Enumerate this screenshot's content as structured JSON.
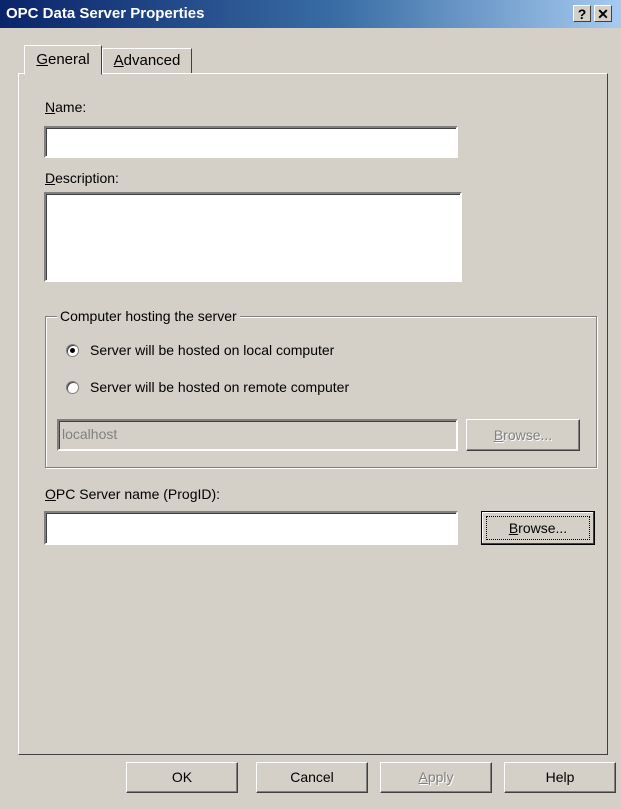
{
  "window": {
    "title": "OPC Data Server Properties",
    "help_glyph": "?",
    "close_glyph": "✕"
  },
  "tabs": [
    {
      "label": "General",
      "mnemonic": "G",
      "rest": "eneral",
      "active": true
    },
    {
      "label": "Advanced",
      "mnemonic": "A",
      "rest": "dvanced",
      "active": false
    }
  ],
  "form": {
    "name_label": {
      "mnemonic": "N",
      "rest": "ame:"
    },
    "name_value": "",
    "description_label": {
      "mnemonic": "D",
      "rest": "escription:"
    },
    "description_value": "",
    "host_group_title": "Computer hosting the server",
    "radio_local": {
      "label": "Server will be hosted on local computer",
      "selected": true
    },
    "radio_remote": {
      "label": "Server will be hosted on remote computer",
      "selected": false
    },
    "remote_host_value": "localhost",
    "remote_browse": {
      "mnemonic": "B",
      "rest": "rowse...",
      "enabled": false
    },
    "progid_label": {
      "mnemonic": "O",
      "rest": "PC Server name (ProgID):"
    },
    "progid_value": "",
    "progid_browse": {
      "mnemonic": "B",
      "rest": "rowse...",
      "enabled": true
    }
  },
  "buttons": {
    "ok": "OK",
    "cancel": "Cancel",
    "apply": {
      "mnemonic": "A",
      "rest": "pply",
      "enabled": false
    },
    "help": "Help"
  }
}
